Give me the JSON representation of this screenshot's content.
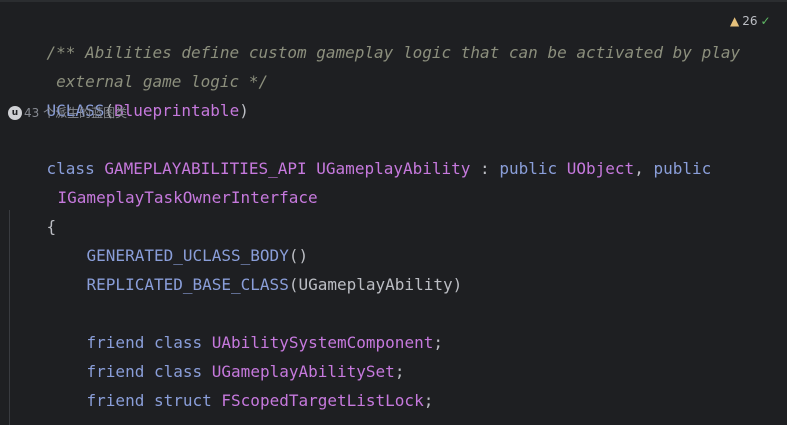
{
  "code": {
    "comment_line1": "/** Abilities define custom gameplay logic that can be activated by play",
    "comment_line2": " external game logic */",
    "uclass_macro": "UCLASS",
    "uclass_args_open": "(",
    "uclass_arg": "Blueprintable",
    "uclass_args_close": ")",
    "class_keyword": "class",
    "api_macro": "GAMEPLAYABILITIES_API",
    "class_name": "UGameplayAbility",
    "colon": " : ",
    "public1": "public",
    "base1": "UObject",
    "comma": ", ",
    "public2": "public",
    "base2": "IGameplayTaskOwnerInterface",
    "open_brace": "{",
    "generated_body": "GENERATED_UCLASS_BODY",
    "generated_parens": "()",
    "replicated_base": "REPLICATED_BASE_CLASS",
    "replicated_open": "(",
    "replicated_arg": "UGameplayAbility",
    "replicated_close": ")",
    "friend1_kw": "friend",
    "friend1_class": "class",
    "friend1_name": "UAbilitySystemComponent",
    "friend1_semi": ";",
    "friend2_kw": "friend",
    "friend2_class": "class",
    "friend2_name": "UGameplayAbilitySet",
    "friend2_semi": ";",
    "friend3_kw": "friend",
    "friend3_struct": "struct",
    "friend3_name": "FScopedTargetListLock",
    "friend3_semi": ";"
  },
  "hint": {
    "icon": "u",
    "text": "43 个派生的蓝图类"
  },
  "inspections": {
    "warning_count": "26",
    "warning_icon": "warning-icon",
    "ok_icon": "check-icon"
  },
  "colors": {
    "background": "#1e1f22",
    "comment": "#8c8f7d",
    "keyword": "#8a9ed9",
    "macro": "#c679dd",
    "text": "#bcbec4"
  }
}
